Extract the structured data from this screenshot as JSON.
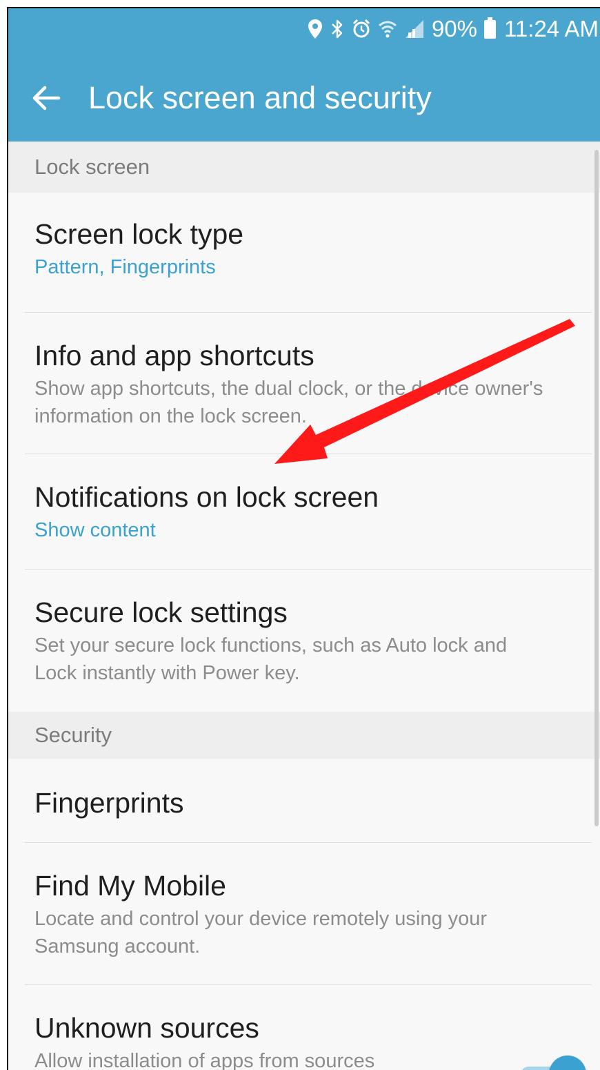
{
  "status_bar": {
    "battery": "90%",
    "time": "11:24 AM"
  },
  "header": {
    "title": "Lock screen and security"
  },
  "sections": {
    "lock_screen": "Lock screen",
    "security": "Security"
  },
  "items": [
    {
      "title": "Screen lock type",
      "subtitle": "Pattern, Fingerprints"
    },
    {
      "title": "Info and app shortcuts",
      "subtitle": "Show app shortcuts, the dual clock, or the device owner's information on the lock screen."
    },
    {
      "title": "Notifications on lock screen",
      "subtitle": "Show content"
    },
    {
      "title": "Secure lock settings",
      "subtitle": "Set your secure lock functions, such as Auto lock and Lock instantly with Power key."
    },
    {
      "title": "Fingerprints"
    },
    {
      "title": "Find My Mobile",
      "subtitle": "Locate and control your device remotely using your Samsung account."
    },
    {
      "title": "Unknown sources",
      "subtitle": "Allow installation of apps from sources"
    }
  ],
  "toggles": {
    "unknown_sources": true
  },
  "icons": [
    "location-icon",
    "bluetooth-icon",
    "alarm-icon",
    "wifi-icon",
    "signal-icon",
    "battery-icon",
    "back-arrow-icon"
  ],
  "colors": {
    "app_bar": "#4aa6cf",
    "accent": "#3aa1d1",
    "annotation_arrow": "#ff1a1a"
  }
}
